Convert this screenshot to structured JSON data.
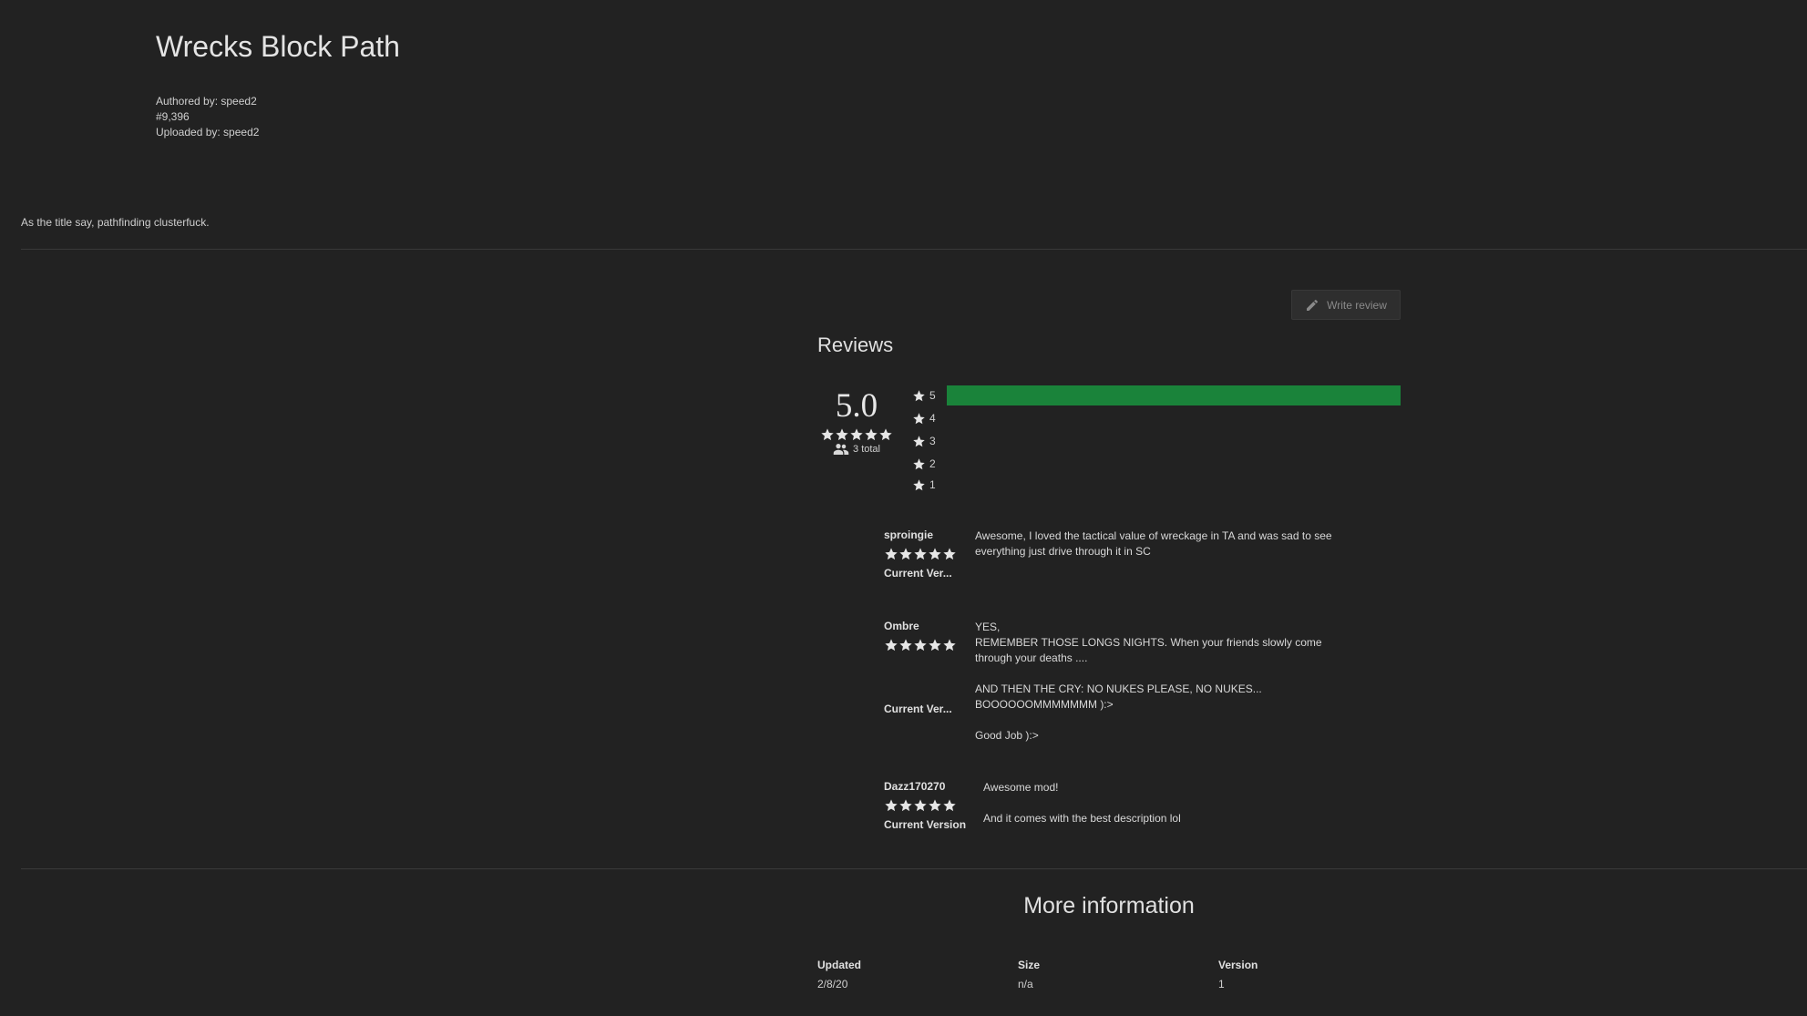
{
  "header": {
    "title": "Wrecks Block Path",
    "authored_by": "Authored by: speed2",
    "id": "#9,396",
    "uploaded_by": "Uploaded by: speed2"
  },
  "description": "As the title say, pathfinding clusterfuck.",
  "reviews_section": {
    "write_review_label": "Write review",
    "title": "Reviews",
    "average": "5.0",
    "total_label": "3 total",
    "histogram": [
      {
        "stars": "5",
        "fraction": 1.0
      },
      {
        "stars": "4",
        "fraction": 0
      },
      {
        "stars": "3",
        "fraction": 0
      },
      {
        "stars": "2",
        "fraction": 0
      },
      {
        "stars": "1",
        "fraction": 0
      }
    ],
    "colors": {
      "bar": "#1a833a",
      "background": "#222222"
    },
    "reviews": [
      {
        "author": "sproingie",
        "rating": 5,
        "version": "Current Ver...",
        "body": [
          "Awesome, I loved the tactical value of wreckage in TA and was sad to see everything just drive through it in SC"
        ]
      },
      {
        "author": "Ombre",
        "rating": 5,
        "version": "Current Ver...",
        "body": [
          "YES,",
          "REMEMBER THOSE LONGS NIGHTS. When your friends slowly come through your deaths ....",
          "AND THEN THE CRY: NO NUKES PLEASE, NO NUKES... BOOOOOOMMMMMMM ):>",
          "Good Job ):>"
        ]
      },
      {
        "author": "Dazz170270",
        "rating": 5,
        "version": "Current Version",
        "body": [
          "Awesome mod!",
          "And it comes with the best description lol"
        ]
      }
    ]
  },
  "more_information": {
    "title": "More information",
    "fields": [
      {
        "label": "Updated",
        "value": "2/8/20"
      },
      {
        "label": "Size",
        "value": "n/a"
      },
      {
        "label": "Version",
        "value": "1"
      }
    ]
  }
}
